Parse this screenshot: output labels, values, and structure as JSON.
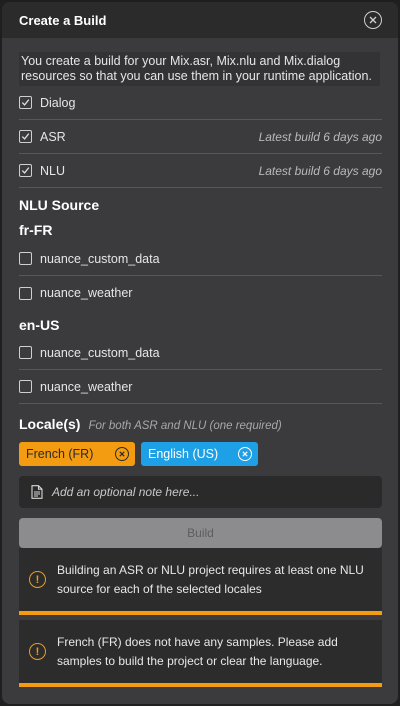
{
  "dialog": {
    "title": "Create a Build"
  },
  "intro": "You create a build for your Mix.asr, Mix.nlu and Mix.dialog resources so that you can use them in your runtime application.",
  "resources": [
    {
      "label": "Dialog",
      "checked": true,
      "meta": ""
    },
    {
      "label": "ASR",
      "checked": true,
      "meta": "Latest build 6 days ago"
    },
    {
      "label": "NLU",
      "checked": true,
      "meta": "Latest build 6 days ago"
    }
  ],
  "nlu_source": {
    "title": "NLU Source",
    "groups": [
      {
        "locale": "fr-FR",
        "items": [
          {
            "label": "nuance_custom_data",
            "checked": false
          },
          {
            "label": "nuance_weather",
            "checked": false
          }
        ]
      },
      {
        "locale": "en-US",
        "items": [
          {
            "label": "nuance_custom_data",
            "checked": false
          },
          {
            "label": "nuance_weather",
            "checked": false
          }
        ]
      }
    ]
  },
  "locales": {
    "title": "Locale(s)",
    "hint": "For both ASR and NLU (one required)",
    "chips": [
      {
        "label": "French (FR)",
        "color": "#f39c12"
      },
      {
        "label": "English (US)",
        "color": "#1ea0e6"
      }
    ]
  },
  "note": {
    "placeholder": "Add an optional note here...",
    "icon": "document-icon"
  },
  "build_button": "Build",
  "alerts": [
    {
      "icon": "warning-icon",
      "text": "Building an ASR or NLU project requires at least one NLU source for each of the selected locales"
    },
    {
      "icon": "warning-icon",
      "text": "French (FR) does not have any samples. Please add samples to build the project or clear the language."
    }
  ],
  "colors": {
    "accent_orange": "#f39c12",
    "accent_blue": "#1ea0e6"
  }
}
